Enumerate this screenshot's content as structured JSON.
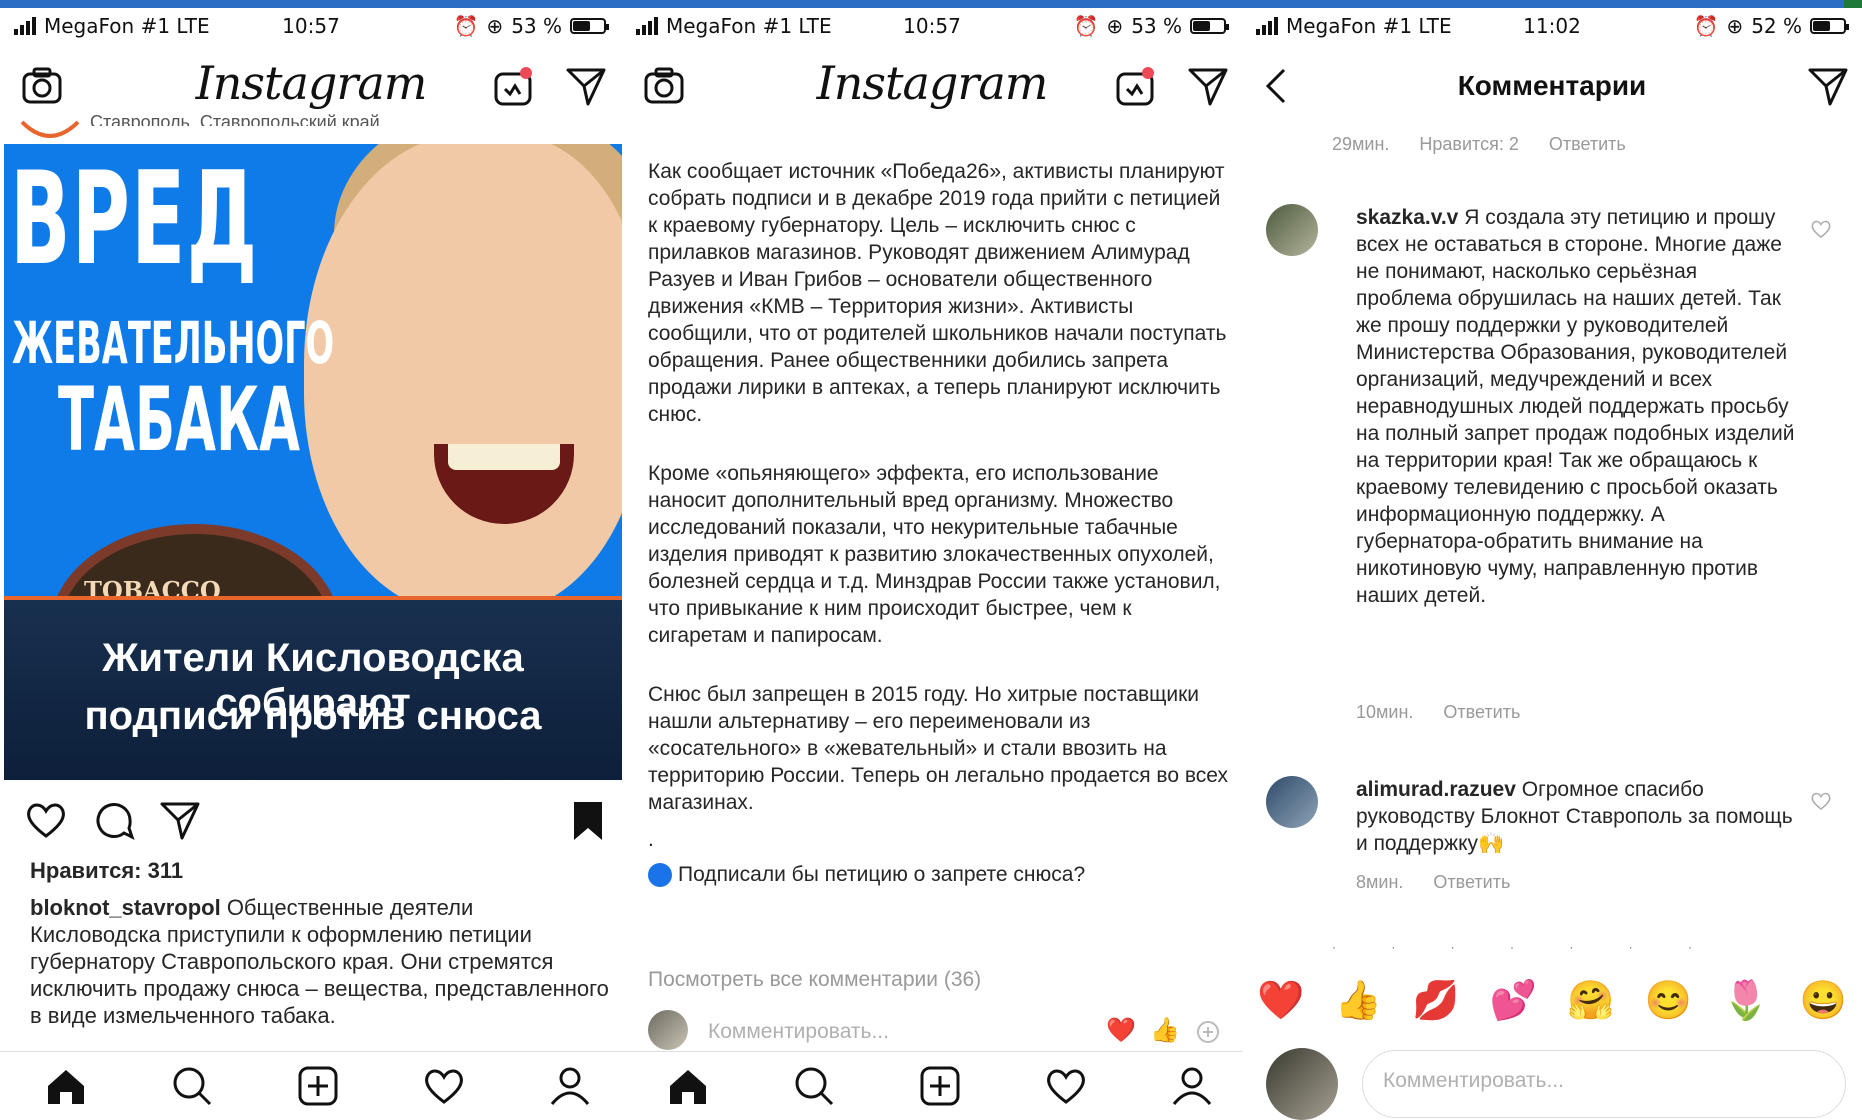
{
  "colors": {
    "accent_blue": "#0f7be8",
    "like_red": "#ed4956",
    "muted": "#999999",
    "text": "#262626",
    "orange_line": "#e8652b"
  },
  "panels": [
    {
      "status": {
        "carrier": "MegaFon #1 LTE",
        "time": "10:57",
        "battery": "53 %",
        "battery_level": 0.53
      },
      "nav": {
        "logo": "Instagram"
      },
      "post": {
        "location": "Ставрополь, Ставропольский край",
        "image": {
          "headline_1": "ВРЕД",
          "headline_2": "ЖЕВАТЕЛЬНОГО",
          "headline_3": "ТАБАКА",
          "tin_label": "TOBACCO",
          "band_line_1": "Жители Кисловодска собирают",
          "band_line_2": "подписи против снюса"
        },
        "likes": "Нравится: 311",
        "caption_user": "bloknot_stavropol",
        "caption_text": "Общественные деятели Кисловодска приступили к оформлению петиции губернатору Ставропольского края. Они стремятся исключить продажу снюса – вещества, представленного в виде измельченного табака."
      }
    },
    {
      "status": {
        "carrier": "MegaFon #1 LTE",
        "time": "10:57",
        "battery": "53 %",
        "battery_level": 0.53
      },
      "nav": {
        "logo": "Instagram"
      },
      "article": {
        "p1": "Как сообщает источник «Победа26», активисты планируют собрать подписи и в декабре 2019 года прийти с петицией к краевому губернатору. Цель – исключить снюс с прилавков магазинов. Руководят движением Алимурад Разуев и Иван Грибов – основатели общественного движения «КМВ – Территория жизни». Активисты сообщили, что от родителей школьников начали поступать обращения. Ранее общественники добились запрета продажи лирики в аптеках, а теперь планируют исключить снюс.",
        "p2": "Кроме «опьяняющего» эффекта, его использование наносит дополнительный вред организму. Множество исследований показали, что некурительные табачные изделия приводят к развитию злокачественных опухолей, болезней сердца и т.д. Минздрав России также установил, что привыкание к ним происходит быстрее, чем к сигаретам и папиросам.",
        "p3": "Снюс был запрещен в 2015 году. Но хитрые поставщики нашли альтернативу – его переименовали из «сосательного» в «жевательный» и стали ввозить на территорию России. Теперь он легально продается во всех магазинах.",
        "dot": ".",
        "poll": "Подписали бы петицию о запрете снюса?",
        "view_all": "Посмотреть все комментарии (36)",
        "comment_placeholder": "Комментировать...",
        "emoji_1": "❤️",
        "emoji_2": "👍"
      }
    },
    {
      "status": {
        "carrier": "MegaFon #1 LTE",
        "time": "11:02",
        "battery": "52 %",
        "battery_level": 0.52
      },
      "nav": {
        "title": "Комментарии"
      },
      "top_meta": {
        "time": "29мин.",
        "likes": "Нравится: 2",
        "reply": "Ответить"
      },
      "comments": [
        {
          "user": "skazka.v.v",
          "text": "Я создала эту петицию  и прошу всех не оставаться в стороне. Многие даже не понимают, насколько серьёзная проблема обрушилась на наших детей. Так же прошу поддержки у руководителей Министерства Образования, руководителей организаций, медучреждений  и всех неравнодушных людей поддержать просьбу на полный запрет продаж подобных изделий на территории края! Так же обращаюсь к краевому телевидению с просьбой оказать информационную поддержку. А губернатора-обратить внимание на никотиновую чуму,  направленную против наших детей.",
          "time": "10мин.",
          "reply": "Ответить"
        },
        {
          "user": "alimurad.razuev",
          "text": "Огромное спасибо руководству Блокнот Ставрополь за помощь и поддержку🙌",
          "time": "8мин.",
          "reply": "Ответить"
        }
      ],
      "dots": "· · · · · · ·",
      "emoji_bar": [
        "❤️",
        "👍",
        "💋",
        "💕",
        "🤗",
        "😊",
        "🌷",
        "😀"
      ],
      "reply_placeholder": "Комментировать..."
    }
  ]
}
